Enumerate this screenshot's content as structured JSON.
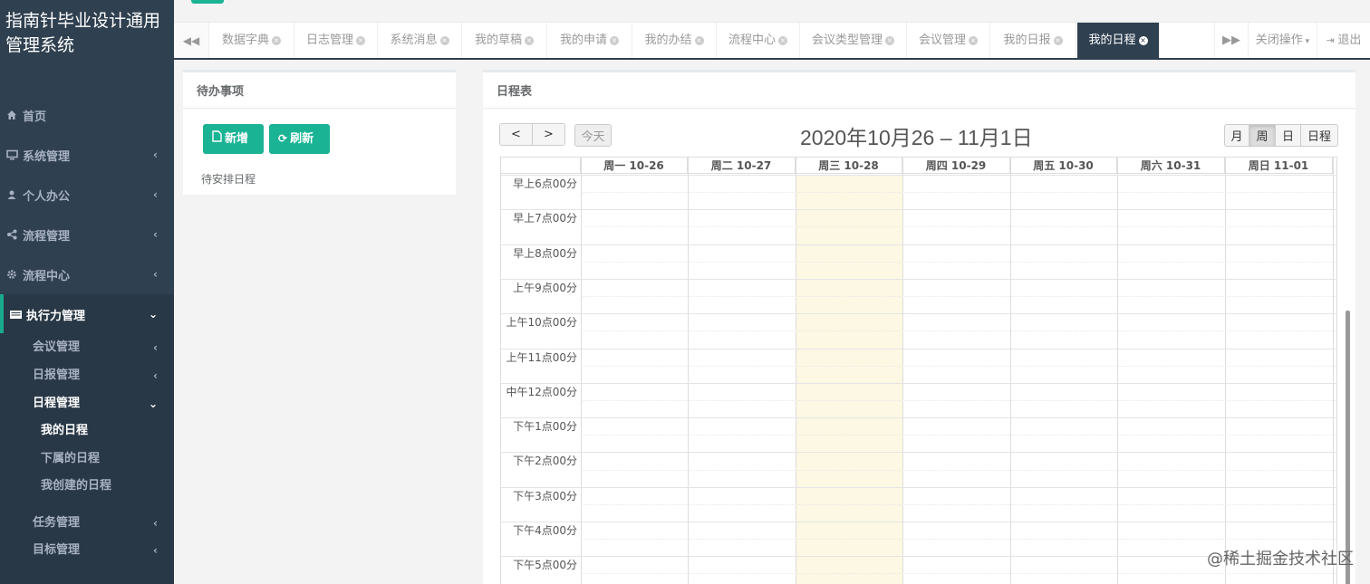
{
  "app": {
    "title": "指南针毕业设计通用管理系统"
  },
  "sidebar": {
    "items": [
      {
        "label": "首页",
        "icon": "home-icon"
      },
      {
        "label": "系统管理",
        "icon": "desktop-icon"
      },
      {
        "label": "个人办公",
        "icon": "user-icon"
      },
      {
        "label": "流程管理",
        "icon": "share-icon"
      },
      {
        "label": "流程中心",
        "icon": "gear-icon"
      },
      {
        "label": "执行力管理",
        "icon": "list-icon"
      }
    ],
    "sub_items": [
      {
        "label": "会议管理"
      },
      {
        "label": "日报管理"
      },
      {
        "label": "日程管理"
      },
      {
        "label": "任务管理"
      },
      {
        "label": "目标管理"
      }
    ],
    "sub2_items": [
      {
        "label": "我的日程"
      },
      {
        "label": "下属的日程"
      },
      {
        "label": "我创建的日程"
      }
    ]
  },
  "tabs": {
    "items": [
      {
        "label": "数据字典"
      },
      {
        "label": "日志管理"
      },
      {
        "label": "系统消息"
      },
      {
        "label": "我的草稿"
      },
      {
        "label": "我的申请"
      },
      {
        "label": "我的办结"
      },
      {
        "label": "流程中心"
      },
      {
        "label": "会议类型管理"
      },
      {
        "label": "会议管理"
      },
      {
        "label": "我的日报"
      },
      {
        "label": "我的日程"
      }
    ],
    "close_ops": "关闭操作",
    "logout": "退出"
  },
  "pending": {
    "title": "待办事项",
    "add_label": "新增",
    "refresh_label": "刷新",
    "empty_text": "待安排日程"
  },
  "schedule": {
    "title": "日程表",
    "today_label": "今天",
    "range_title": "2020年10月26 – 11月1日",
    "views": [
      "月",
      "周",
      "日",
      "日程"
    ],
    "active_view": "周",
    "days": [
      "周一 10-26",
      "周二 10-27",
      "周三 10-28",
      "周四 10-29",
      "周五 10-30",
      "周六 10-31",
      "周日 11-01"
    ],
    "today_index": 2,
    "times": [
      "早上6点00分",
      "早上7点00分",
      "早上8点00分",
      "上午9点00分",
      "上午10点00分",
      "上午11点00分",
      "中午12点00分",
      "下午1点00分",
      "下午2点00分",
      "下午3点00分",
      "下午4点00分",
      "下午5点00分"
    ]
  },
  "watermark": "@稀土掘金技术社区",
  "colors": {
    "sidebar_bg": "#2f4050",
    "accent": "#1ab394",
    "today_bg": "#fcf8e3"
  }
}
